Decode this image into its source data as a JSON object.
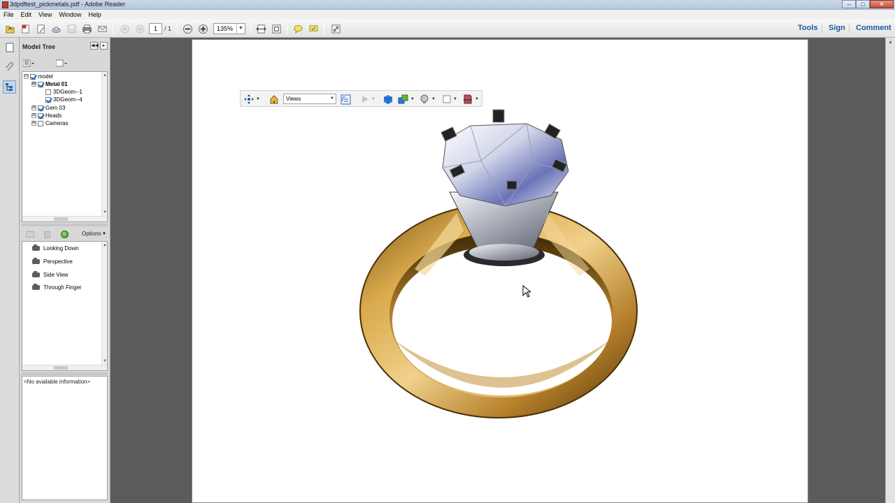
{
  "window": {
    "title": "3dpdftest_pickmetals.pdf - Adobe Reader",
    "minimize": "–",
    "maximize": "□",
    "close": "✕"
  },
  "menu": [
    "File",
    "Edit",
    "View",
    "Window",
    "Help"
  ],
  "toolbar": {
    "page_current": "1",
    "page_total": "/ 1",
    "zoom": "135%",
    "right_links": [
      "Tools",
      "Sign",
      "Comment"
    ]
  },
  "model_tree": {
    "title": "Model Tree",
    "nodes": [
      {
        "label": "model",
        "level": 0,
        "expander": "⊟",
        "checked": true,
        "bold": false
      },
      {
        "label": "Metal 01",
        "level": 1,
        "expander": "⊟",
        "checked": true,
        "bold": true
      },
      {
        "label": "3DGeom--1",
        "level": 2,
        "expander": "",
        "checked": false,
        "bold": false
      },
      {
        "label": "3DGeom--4",
        "level": 2,
        "expander": "",
        "checked": true,
        "bold": false
      },
      {
        "label": "Gem 03",
        "level": 1,
        "expander": "⊞",
        "checked": true,
        "bold": false
      },
      {
        "label": "Heads",
        "level": 1,
        "expander": "⊞",
        "checked": true,
        "bold": false
      },
      {
        "label": "Cameras",
        "level": 1,
        "expander": "⊞",
        "checked": false,
        "bold": false
      }
    ],
    "views_options": "Options",
    "views": [
      "Looking Down",
      "Perspective",
      "Side View",
      "Through Finger"
    ],
    "info": "<No available information>"
  },
  "toolbar3d": {
    "views_label": "Views"
  },
  "colors": {
    "gold": "#c8953a",
    "silver": "#c9ccd3",
    "link_blue": "#1d5a9c"
  }
}
